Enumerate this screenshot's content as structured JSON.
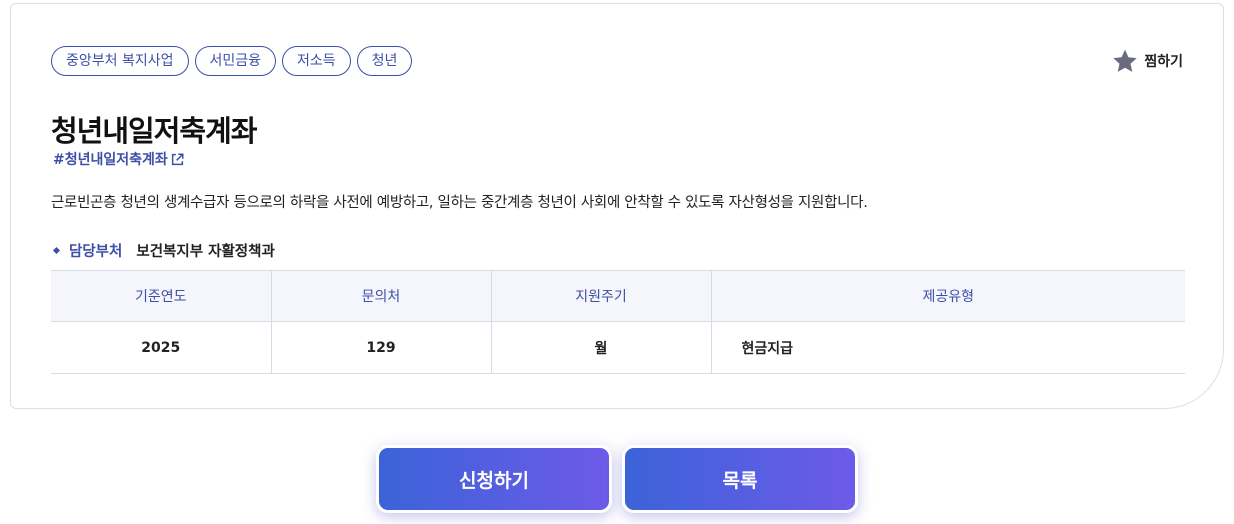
{
  "tags": [
    "중앙부처 복지사업",
    "서민금융",
    "저소득",
    "청년"
  ],
  "wish_label": "찜하기",
  "title": "청년내일저축계좌",
  "hashtag": "#청년내일저축계좌",
  "description": "근로빈곤층 청년의 생계수급자 등으로의 하락을 사전에 예방하고, 일하는 중간계층 청년이 사회에 안착할 수 있도록 자산형성을 지원합니다.",
  "department": {
    "label": "담당부처",
    "value": "보건복지부 자활정책과"
  },
  "table": {
    "headers": [
      "기준연도",
      "문의처",
      "지원주기",
      "제공유형"
    ],
    "row": [
      "2025",
      "129",
      "월",
      "현금지급"
    ]
  },
  "buttons": {
    "apply": "신청하기",
    "list": "목록"
  },
  "colors": {
    "accent": "#3e4fa8",
    "button_gradient_start": "#3b63d8",
    "button_gradient_end": "#6d5ae8",
    "star": "#6b6b80"
  },
  "icons": {
    "wish": "star-icon",
    "hashtag_link": "external-link-icon",
    "dept_bullet": "diamond-bullet-icon"
  }
}
